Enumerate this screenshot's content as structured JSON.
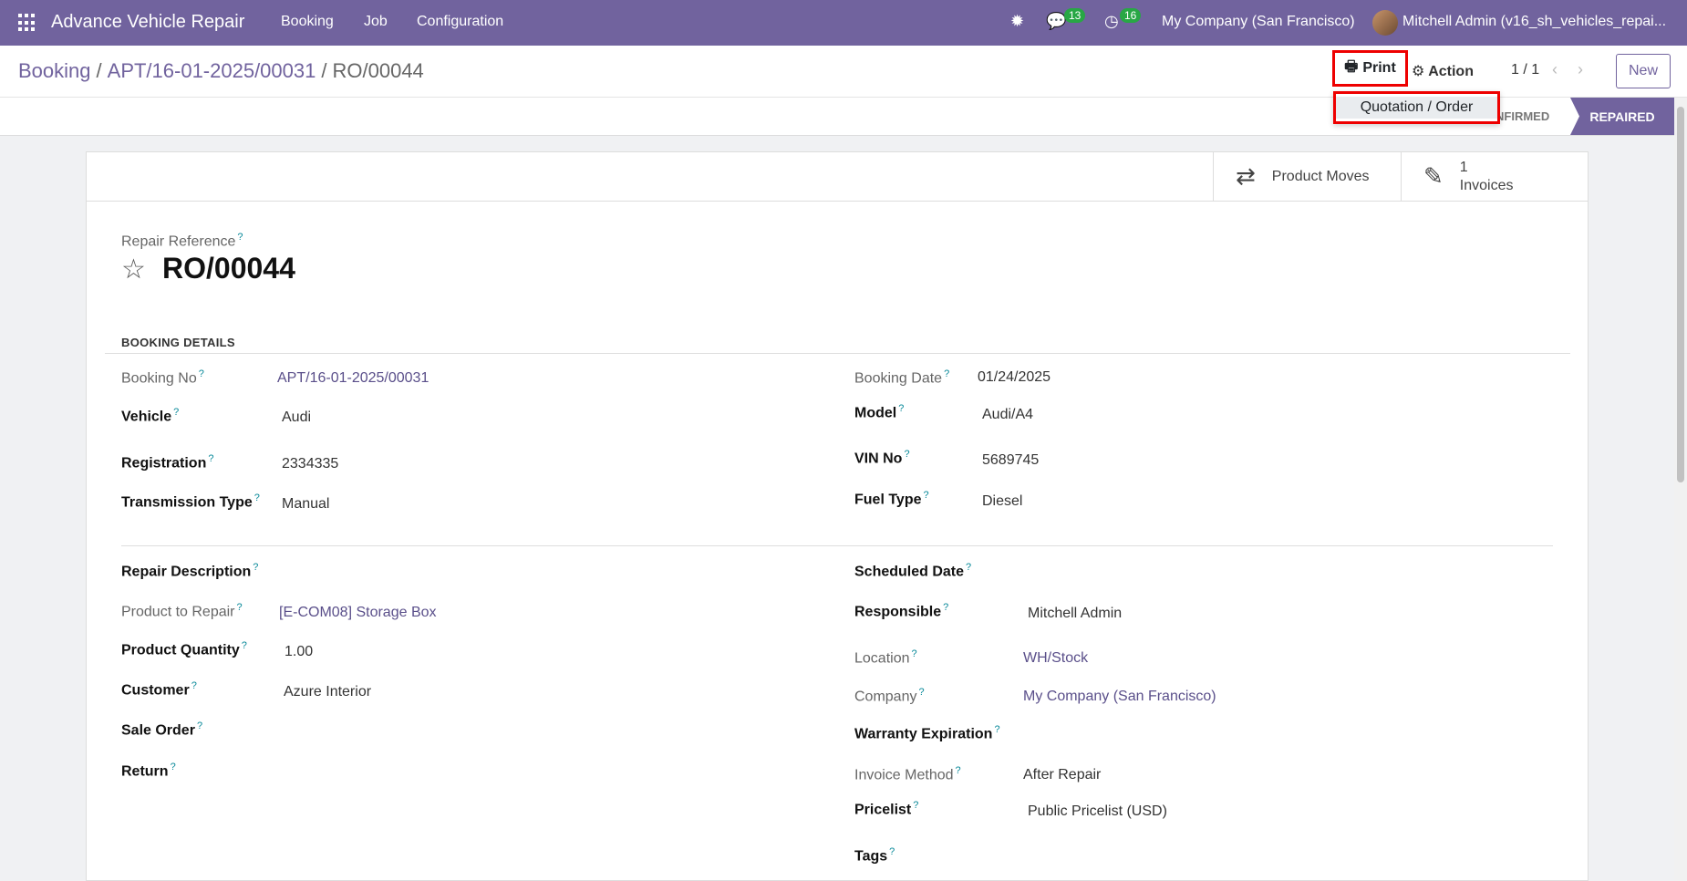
{
  "navbar": {
    "app_title": "Advance Vehicle Repair",
    "menu": [
      "Booking",
      "Job",
      "Configuration"
    ],
    "messages_count": "13",
    "activities_count": "16",
    "company": "My Company (San Francisco)",
    "user": "Mitchell Admin (v16_sh_vehicles_repai..."
  },
  "breadcrumb": {
    "root": "Booking",
    "booking": "APT/16-01-2025/00031",
    "current": "RO/00044",
    "separator": "/"
  },
  "toolbar": {
    "print_label": "Print",
    "action_label": "Action",
    "pager": "1 / 1",
    "new_label": "New"
  },
  "print_dropdown": {
    "items": [
      "Quotation / Order"
    ]
  },
  "status": {
    "confirmed": "NFIRMED",
    "repaired": "REPAIRED"
  },
  "smart_buttons": {
    "product_moves": "Product Moves",
    "invoices_count": "1",
    "invoices_label": "Invoices"
  },
  "record": {
    "ref_label": "Repair Reference",
    "name": "RO/00044"
  },
  "booking_details": {
    "title": "BOOKING DETAILS",
    "booking_no_label": "Booking No",
    "booking_no": "APT/16-01-2025/00031",
    "vehicle_label": "Vehicle",
    "vehicle": "Audi",
    "registration_label": "Registration",
    "registration": "2334335",
    "transmission_label": "Transmission Type",
    "transmission": "Manual",
    "booking_date_label": "Booking Date",
    "booking_date": "01/24/2025",
    "model_label": "Model",
    "model": "Audi/A4",
    "vin_label": "VIN No",
    "vin": "5689745",
    "fuel_label": "Fuel Type",
    "fuel": "Diesel"
  },
  "repair": {
    "description_label": "Repair Description",
    "product_label": "Product to Repair",
    "product": "[E-COM08] Storage Box",
    "quantity_label": "Product Quantity",
    "quantity": "1.00",
    "customer_label": "Customer",
    "customer": "Azure Interior",
    "sale_order_label": "Sale Order",
    "return_label": "Return",
    "scheduled_label": "Scheduled Date",
    "responsible_label": "Responsible",
    "responsible": "Mitchell Admin",
    "location_label": "Location",
    "location": "WH/Stock",
    "company_label": "Company",
    "company": "My Company (San Francisco)",
    "warranty_label": "Warranty Expiration",
    "invoice_method_label": "Invoice Method",
    "invoice_method": "After Repair",
    "pricelist_label": "Pricelist",
    "pricelist": "Public Pricelist (USD)",
    "tags_label": "Tags"
  },
  "help_mark": "?",
  "colors": {
    "brand": "#71639e",
    "highlight": "#ee0000",
    "badge": "#28a745"
  }
}
